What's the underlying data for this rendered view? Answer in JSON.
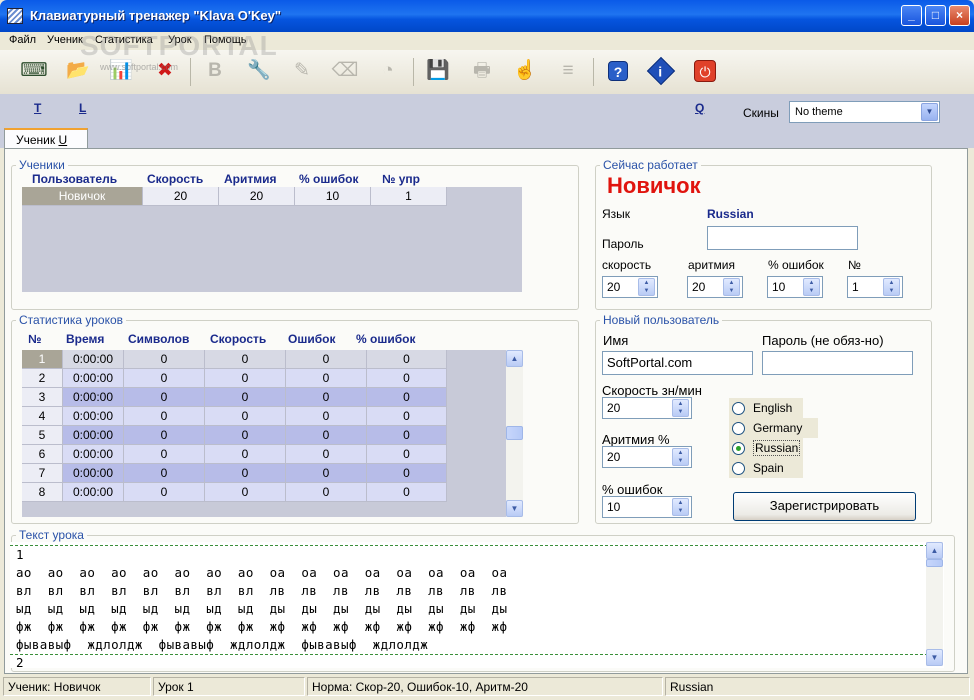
{
  "window": {
    "title": "Клавиатурный тренажер \"Klava O'Key\"",
    "min": "_",
    "max": "□",
    "close": "×"
  },
  "menu": [
    "Файл",
    "Ученик",
    "Статистика",
    "Урок",
    "Помощь"
  ],
  "watermark": {
    "brand": "SOFTPORTAL",
    "url": "www.softportal.com"
  },
  "toolbar": {
    "buttons": [
      {
        "name": "typewriter",
        "glyph": "⌨"
      },
      {
        "name": "open-folder",
        "glyph": "📂"
      },
      {
        "name": "statistics",
        "glyph": "📊"
      },
      {
        "name": "delete-user",
        "glyph": "✖"
      },
      {
        "name": "bold-b",
        "glyph": "B"
      },
      {
        "name": "tools",
        "glyph": "🔧"
      },
      {
        "name": "edit",
        "glyph": "✎"
      },
      {
        "name": "backspace",
        "glyph": "⌫"
      },
      {
        "name": "timer",
        "glyph": "◔"
      },
      {
        "name": "save",
        "glyph": "💾"
      },
      {
        "name": "print",
        "glyph": "🖶"
      },
      {
        "name": "hand",
        "glyph": "☝"
      },
      {
        "name": "text-lines",
        "glyph": "≡"
      },
      {
        "name": "help",
        "glyph": "?"
      },
      {
        "name": "info",
        "glyph": "i"
      },
      {
        "name": "power",
        "glyph": "⏻"
      }
    ]
  },
  "band": {
    "link_t": "T",
    "link_l": "L",
    "link_q": "Q",
    "skins_label": "Скины",
    "skin_value": "No theme"
  },
  "tab": {
    "label": "Ученик",
    "hotkey": "U"
  },
  "students": {
    "legend": "Ученики",
    "columns": [
      "Пользователь",
      "Скорость",
      "Аритмия",
      "% ошибок",
      "№ упр"
    ],
    "rows": [
      [
        "Новичок",
        "20",
        "20",
        "10",
        "1"
      ]
    ]
  },
  "current": {
    "legend": "Сейчас работает",
    "name": "Новичок",
    "lang_label": "Язык",
    "lang_value": "Russian",
    "password_label": "Пароль",
    "speed_label": "скорость",
    "arr_label": "аритмия",
    "err_label": "% ошибок",
    "num_label": "№",
    "speed_val": "20",
    "arr_val": "20",
    "err_val": "10",
    "num_val": "1"
  },
  "lessons": {
    "legend": "Статистика уроков",
    "columns": [
      "№",
      "Время",
      "Символов",
      "Скорость",
      "Ошибок",
      "% ошибок"
    ],
    "rows": [
      [
        "1",
        "0:00:00",
        "0",
        "0",
        "0",
        "0"
      ],
      [
        "2",
        "0:00:00",
        "0",
        "0",
        "0",
        "0"
      ],
      [
        "3",
        "0:00:00",
        "0",
        "0",
        "0",
        "0"
      ],
      [
        "4",
        "0:00:00",
        "0",
        "0",
        "0",
        "0"
      ],
      [
        "5",
        "0:00:00",
        "0",
        "0",
        "0",
        "0"
      ],
      [
        "6",
        "0:00:00",
        "0",
        "0",
        "0",
        "0"
      ],
      [
        "7",
        "0:00:00",
        "0",
        "0",
        "0",
        "0"
      ],
      [
        "8",
        "0:00:00",
        "0",
        "0",
        "0",
        "0"
      ]
    ]
  },
  "newuser": {
    "legend": "Новый пользователь",
    "name_label": "Имя",
    "name_value": "SoftPortal.com",
    "pass_label": "Пароль (не обяз-но)",
    "speed_label": "Скорость зн/мин",
    "speed_val": "20",
    "arr_label": "Аритмия %",
    "arr_val": "20",
    "err_label": "% ошибок",
    "err_val": "10",
    "languages": [
      "English",
      "Germany",
      "Russian",
      "Spain"
    ],
    "selected_language": "Russian",
    "register": "Зарегистрировать"
  },
  "lesson_text": {
    "legend": "Текст урока",
    "lines": [
      "1",
      "ао  ао  ао  ао  ао  ао  ао  ао  оа  оа  оа  оа  оа  оа  оа  оа",
      "вл  вл  вл  вл  вл  вл  вл  вл  лв  лв  лв  лв  лв  лв  лв  лв",
      "ыд  ыд  ыд  ыд  ыд  ыд  ыд  ыд  ды  ды  ды  ды  ды  ды  ды  ды",
      "фж  фж  фж  фж  фж  фж  фж  фж  жф  жф  жф  жф  жф  жф  жф  жф",
      "фывавыф  ждлолдж  фывавыф  ждлолдж  фывавыф  ждлолдж",
      "2"
    ]
  },
  "status": {
    "student": "Ученик: Новичок",
    "lesson": "Урок 1",
    "norm": "Норма: Скор-20,  Ошибок-10,  Аритм-20",
    "lang": "Russian"
  }
}
